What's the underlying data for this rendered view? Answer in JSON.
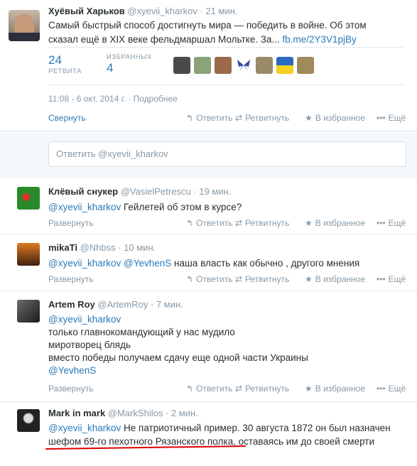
{
  "main": {
    "name": "Хуёвый Харьков",
    "handle": "@xyevii_kharkov",
    "time": "· 21 мин.",
    "text_line1": "Самый быстрый способ достигнуть мира — победить в войне. Об этом",
    "text_line2_prefix": "сказал ещё в XIX веке фельдмаршал Мольтке. За...",
    "text_link": "fb.me/2Y3V1pjBy",
    "retweets_count": "24",
    "retweets_label": "РЕТВИТА",
    "favorites_label": "ИЗБРАННЫХ",
    "favorites_count": "4",
    "timestamp": "11:08 - 6 окт. 2014 г. · Подробнее",
    "collapse": "Свернуть",
    "reply_label": "Ответить",
    "retweet_label": "Ретвитнуть",
    "favorite_label": "В избранное",
    "more_label": "Ещё"
  },
  "reply_box": {
    "placeholder": "Ответить @xyevii_kharkov"
  },
  "replies": [
    {
      "name": "Клёвый снукер",
      "handle": "@VasielPetrescu",
      "time": "· 19 мин.",
      "mention": "@xyevii_kharkov",
      "text": "Гейлетей об этом в курсе?",
      "expand": "Развернуть"
    },
    {
      "name": "mikaTi",
      "handle": "@Nhbss",
      "time": "· 10 мин.",
      "mention": "@xyevii_kharkov",
      "mention2": "@YevhenS",
      "text": "наша власть как обычно , другого мнения",
      "expand": "Развернуть"
    },
    {
      "name": "Artem Roy",
      "handle": "@ArtemRoy",
      "time": "· 7 мин.",
      "mention": "@xyevii_kharkov",
      "line1": "только главнокомандующий у нас мудило",
      "line2": "миротворец блядь",
      "line3": "вместо победы получаем сдачу еще одной части Украины",
      "mention2": "@YevhenS",
      "expand": "Развернуть"
    },
    {
      "name": "Mark in mark",
      "handle": "@MarkShilos",
      "time": "· 2 мин.",
      "mention": "@xyevii_kharkov",
      "line1": "Не патриотичный пример. 30 августа 1872 он был назначен",
      "line2": "шефом 69-го пехотного Рязанского полка, оставаясь им до своей смерти"
    }
  ],
  "colors": {
    "link": "#2b7bb9",
    "muted": "#8899a6",
    "underline": "#dd0000"
  }
}
